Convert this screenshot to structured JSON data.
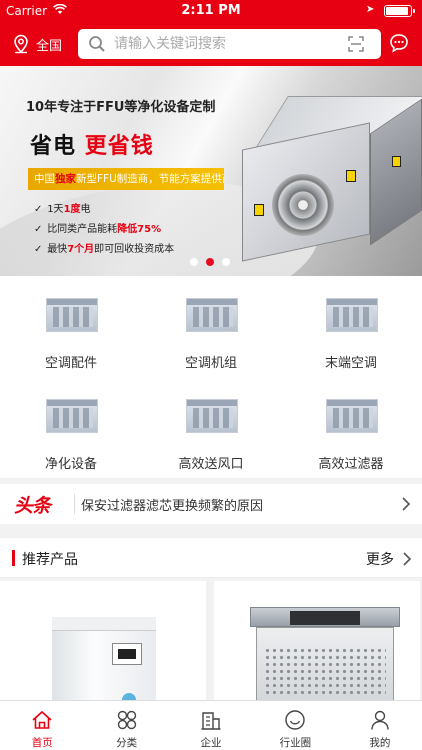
{
  "status_bar": {
    "carrier": "Carrier",
    "time": "2:11 PM"
  },
  "header": {
    "region_label": "全国",
    "search_placeholder": "请输入关键词搜索",
    "icons": [
      "location-icon",
      "search-icon",
      "scan-icon",
      "message-icon"
    ]
  },
  "banner": {
    "headline": "10年专注于FFU等净化设备定制",
    "slogan_black": "省电",
    "slogan_red": "更省钱",
    "ribbon_a": "中国",
    "ribbon_b": "独家",
    "ribbon_c": "新型FFU制造商，节能方案提供商",
    "bullets": [
      {
        "pre": "1天",
        "hl": "1度",
        "post": "电"
      },
      {
        "pre": "比同类产品能耗",
        "hl": "降低75%",
        "post": ""
      },
      {
        "pre": "最快",
        "hl": "7个月",
        "post": "即可回收投资成本"
      }
    ],
    "slides_total": 3,
    "active_slide": 2,
    "colors": {
      "accent": "#e60012",
      "ribbon": "#f6c000"
    }
  },
  "categories": [
    {
      "label": "空调配件"
    },
    {
      "label": "空调机组"
    },
    {
      "label": "末端空调"
    },
    {
      "label": "净化设备"
    },
    {
      "label": "高效送风口"
    },
    {
      "label": "高效过滤器"
    }
  ],
  "news": {
    "tag": "头条",
    "text": "保安过滤器滤芯更换频繁的原因"
  },
  "recommended": {
    "title": "推荐产品",
    "more": "更多"
  },
  "tabbar": [
    {
      "label": "首页",
      "icon": "home-icon",
      "active": true
    },
    {
      "label": "分类",
      "icon": "category-icon",
      "active": false
    },
    {
      "label": "企业",
      "icon": "enterprise-icon",
      "active": false
    },
    {
      "label": "行业圈",
      "icon": "circle-icon",
      "active": false
    },
    {
      "label": "我的",
      "icon": "user-icon",
      "active": false
    }
  ]
}
